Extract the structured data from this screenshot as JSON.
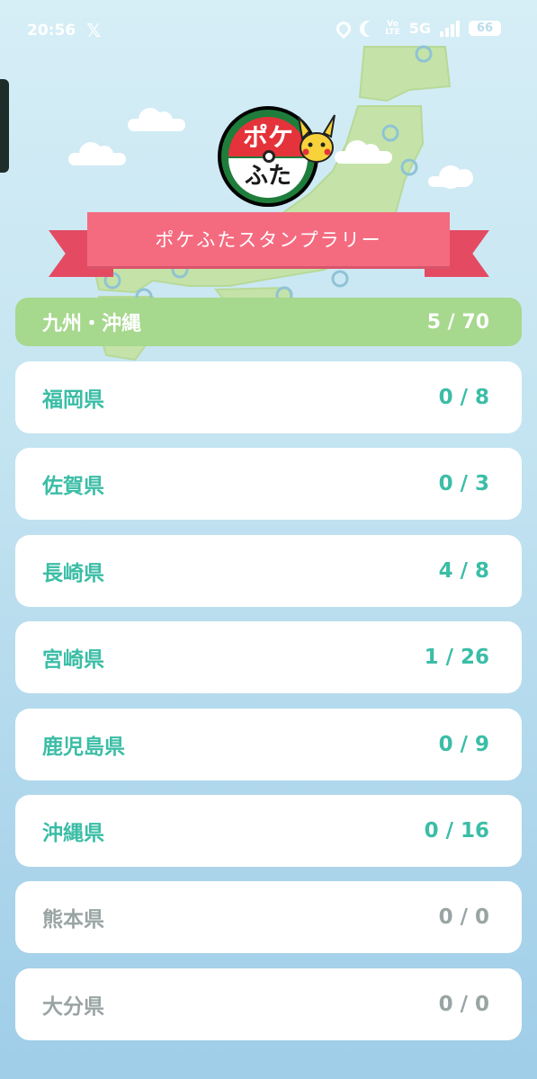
{
  "status_bar": {
    "time": "20:56",
    "app_icon": "x-icon",
    "volte_top": "Vo",
    "volte_bottom": "LTE",
    "network": "5G",
    "battery": "66"
  },
  "banner": {
    "title": "ポケふたスタンプラリー"
  },
  "logo": {
    "top_text": "ポケ",
    "bottom_text": "ふた"
  },
  "region": {
    "name": "九州・沖縄",
    "count": "5 / 70"
  },
  "prefectures": [
    {
      "name": "福岡県",
      "count": "0 / 8",
      "active": true
    },
    {
      "name": "佐賀県",
      "count": "0 / 3",
      "active": true
    },
    {
      "name": "長崎県",
      "count": "4 / 8",
      "active": true
    },
    {
      "name": "宮崎県",
      "count": "1 / 26",
      "active": true
    },
    {
      "name": "鹿児島県",
      "count": "0 / 9",
      "active": true
    },
    {
      "name": "沖縄県",
      "count": "0 / 16",
      "active": true
    },
    {
      "name": "熊本県",
      "count": "0 / 0",
      "active": false
    },
    {
      "name": "大分県",
      "count": "0 / 0",
      "active": false
    }
  ],
  "colors": {
    "accent_teal": "#3bbda6",
    "inactive_gray": "#9aa4a4",
    "region_green": "#a6d88d",
    "banner_pink": "#f46b80"
  }
}
